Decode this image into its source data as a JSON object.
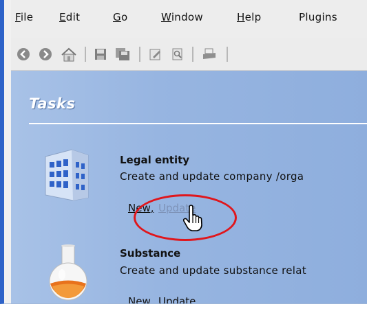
{
  "menu": {
    "items": [
      {
        "label": "File",
        "mnemonic": "F",
        "rest": "ile"
      },
      {
        "label": "Edit",
        "mnemonic": "E",
        "rest": "dit"
      },
      {
        "label": "Go",
        "mnemonic": "G",
        "rest": "o"
      },
      {
        "label": "Window",
        "mnemonic": "W",
        "rest": "indow"
      },
      {
        "label": "Help",
        "mnemonic": "H",
        "rest": "elp"
      },
      {
        "label": "Plugins",
        "mnemonic": "",
        "rest": "Plugins"
      }
    ]
  },
  "toolbar": {
    "icons": [
      "back-icon",
      "forward-icon",
      "home-icon",
      "save-icon",
      "save-all-icon",
      "edit-icon",
      "preview-icon",
      "print-icon"
    ]
  },
  "tasks": {
    "title": "Tasks",
    "entries": [
      {
        "title": "Legal entity",
        "description": "Create and update company /orga",
        "new_label": "New,",
        "update_label": "Update"
      },
      {
        "title": "Substance",
        "description": "Create and update substance relat",
        "new_label": "New,",
        "update_label": "Update"
      }
    ]
  },
  "colors": {
    "highlight": "#e0161c",
    "panel": "#97b5e1",
    "frame_accent": "#2e63c9"
  }
}
